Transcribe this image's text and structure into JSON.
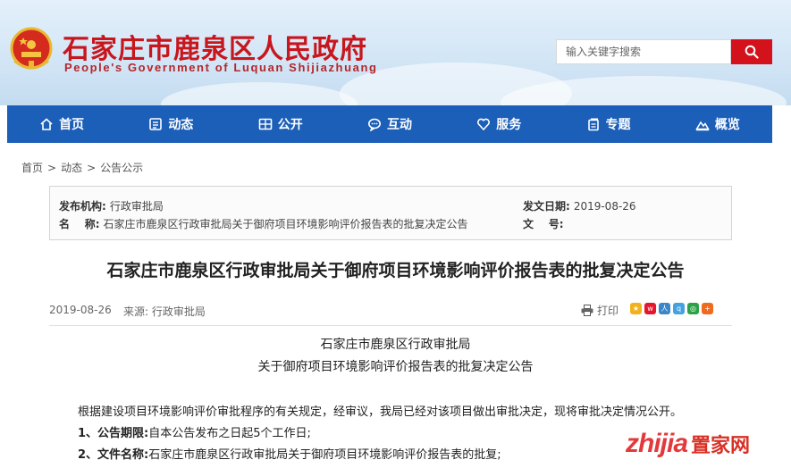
{
  "header": {
    "title": "石家庄市鹿泉区人民政府",
    "subtitle": "People's Government of Luquan Shijiazhuang",
    "search_placeholder": "输入关键字搜索"
  },
  "nav": {
    "items": [
      {
        "label": "首页",
        "icon": "home-icon"
      },
      {
        "label": "动态",
        "icon": "news-icon"
      },
      {
        "label": "公开",
        "icon": "grid-icon"
      },
      {
        "label": "互动",
        "icon": "chat-icon"
      },
      {
        "label": "服务",
        "icon": "heart-icon"
      },
      {
        "label": "专题",
        "icon": "topic-icon"
      },
      {
        "label": "概览",
        "icon": "mountain-icon"
      }
    ]
  },
  "breadcrumb": [
    "首页",
    "动态",
    "公告公示"
  ],
  "meta": {
    "publisher_label": "发布机构:",
    "publisher": "行政审批局",
    "date_label": "发文日期:",
    "date": "2019-08-26",
    "name_label": "名    称:",
    "name": "石家庄市鹿泉区行政审批局关于御府项目环境影响评价报告表的批复决定公告",
    "docno_label": "文    号:",
    "docno": ""
  },
  "article": {
    "title": "石家庄市鹿泉区行政审批局关于御府项目环境影响评价报告表的批复决定公告",
    "date": "2019-08-26",
    "source": "来源: 行政审批局",
    "print_label": "打印",
    "head_line1": "石家庄市鹿泉区行政审批局",
    "head_line2": "关于御府项目环境影响评价报告表的批复决定公告",
    "intro": "根据建设项目环境影响评价审批程序的有关规定，经审议，我局已经对该项目做出审批决定，现将审批决定情况公开。",
    "item1_label": "1、公告期限:",
    "item1_text": "自本公告发布之日起5个工作日;",
    "item2_label": "2、文件名称:",
    "item2_text": "石家庄市鹿泉区行政审批局关于御府项目环境影响评价报告表的批复;"
  },
  "watermark": {
    "brand": "zhijia",
    "cn": "置家网"
  },
  "colors": {
    "accent": "#c8161d",
    "nav": "#1c5fb8",
    "search_btn": "#d3121b"
  }
}
